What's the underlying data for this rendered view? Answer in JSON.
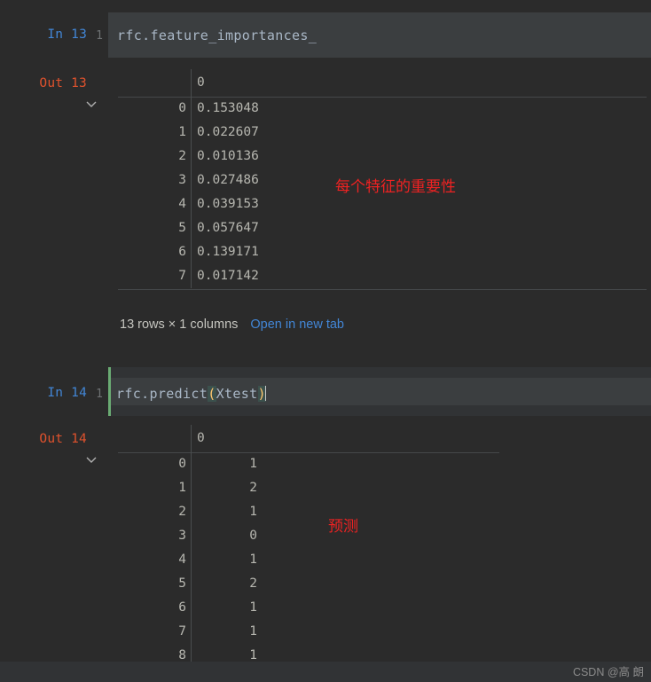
{
  "cell_in_13": {
    "prompt": "In 13",
    "line_number": "1",
    "code": "rfc.feature_importances_"
  },
  "cell_out_13": {
    "prompt": "Out 13",
    "chevron_icon": "chevron-down-icon",
    "column_header": "0",
    "rows": [
      {
        "index": "0",
        "value": "0.153048"
      },
      {
        "index": "1",
        "value": "0.022607"
      },
      {
        "index": "2",
        "value": "0.010136"
      },
      {
        "index": "3",
        "value": "0.027486"
      },
      {
        "index": "4",
        "value": "0.039153"
      },
      {
        "index": "5",
        "value": "0.057647"
      },
      {
        "index": "6",
        "value": "0.139171"
      },
      {
        "index": "7",
        "value": "0.017142"
      }
    ],
    "footer_shape": "13 rows × 1 columns",
    "footer_link": "Open in new tab",
    "annotation": "每个特征的重要性"
  },
  "cell_in_14": {
    "prompt": "In 14",
    "line_number": "1",
    "code_prefix": "rfc.predict",
    "code_open_paren": "(",
    "code_arg": "Xtest",
    "code_close_paren": ")"
  },
  "cell_out_14": {
    "prompt": "Out 14",
    "chevron_icon": "chevron-down-icon",
    "column_header": "0",
    "rows": [
      {
        "index": "0",
        "value": "1"
      },
      {
        "index": "1",
        "value": "2"
      },
      {
        "index": "2",
        "value": "1"
      },
      {
        "index": "3",
        "value": "0"
      },
      {
        "index": "4",
        "value": "1"
      },
      {
        "index": "5",
        "value": "2"
      },
      {
        "index": "6",
        "value": "1"
      },
      {
        "index": "7",
        "value": "1"
      },
      {
        "index": "8",
        "value": "1"
      }
    ],
    "annotation": "预测"
  },
  "watermark": "CSDN @高 朗",
  "colors": {
    "background": "#2b2b2b",
    "editor_background": "#3b3e40",
    "in_prompt": "#4286d6",
    "out_prompt": "#e0522d",
    "text": "#b7b7b0",
    "link": "#4286d6",
    "annotation": "#ef2222",
    "active_cell_accent": "#6aab73",
    "bracket_match": "#ffc66d"
  }
}
